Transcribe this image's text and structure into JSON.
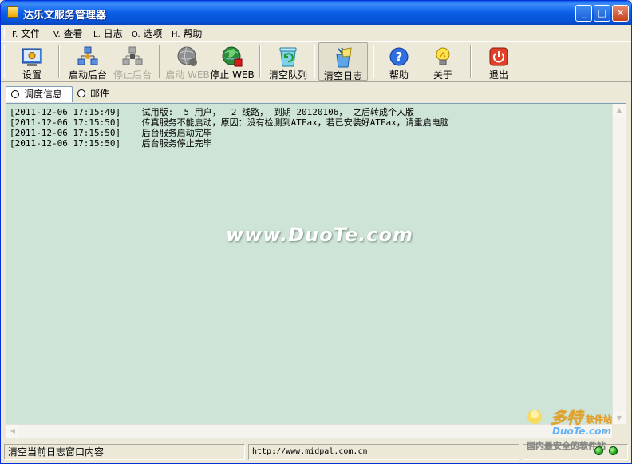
{
  "window": {
    "title": "达乐文服务管理器",
    "min": "_",
    "max": "□",
    "close": "✕"
  },
  "menu": [
    {
      "key": "F.",
      "label": "文件"
    },
    {
      "key": "V.",
      "label": "查看"
    },
    {
      "key": "L.",
      "label": "日志"
    },
    {
      "key": "O.",
      "label": "选项"
    },
    {
      "key": "H.",
      "label": "帮助"
    }
  ],
  "toolbar": {
    "settings": "设置",
    "start_backend": "启动后台",
    "stop_backend": "停止后台",
    "start_web": "启动 WEB",
    "stop_web": "停止 WEB",
    "clear_queue": "清空队列",
    "clear_log": "清空日志",
    "help": "帮助",
    "about": "关于",
    "exit": "退出"
  },
  "tabs": [
    {
      "label": "调度信息",
      "active": true
    },
    {
      "label": "邮件",
      "active": false
    }
  ],
  "log": [
    {
      "time": "[2011-12-06 17:15:49]",
      "msg": "试用版:  5 用户，  2 线路， 到期 20120106， 之后转成个人版"
    },
    {
      "time": "[2011-12-06 17:15:50]",
      "msg": "传真服务不能启动，原因：没有检测到ATFax，若已安装好ATFax，请重启电脑"
    },
    {
      "time": "[2011-12-06 17:15:50]",
      "msg": "后台服务启动完毕"
    },
    {
      "time": "[2011-12-06 17:15:50]",
      "msg": "后台服务停止完毕"
    }
  ],
  "watermark": "www.DuoTe.com",
  "status": {
    "message": "清空当前日志窗口内容",
    "url": "http://www.midpal.com.cn"
  },
  "corner_logo": {
    "name": "多特",
    "suffix": "软件站",
    "domain": "DuoTe.com",
    "tagline": "国内最安全的软件站"
  },
  "colors": {
    "titlebar": "#0a5ae8",
    "log_bg": "#cde4d6",
    "chrome": "#ece9d8",
    "led": "#1fa81f"
  }
}
